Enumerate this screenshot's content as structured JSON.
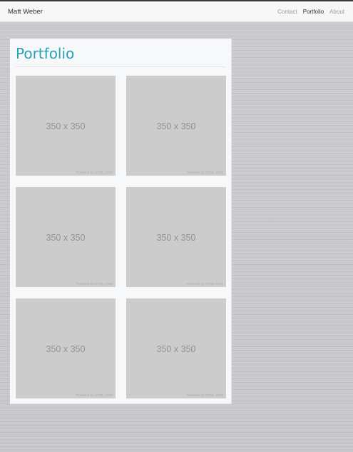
{
  "navbar": {
    "brand": "Matt Weber",
    "links": [
      {
        "label": "Contact",
        "active": false
      },
      {
        "label": "Portfolio",
        "active": true
      },
      {
        "label": "About",
        "active": false
      }
    ]
  },
  "panel": {
    "title": "Portfolio",
    "title_color": "#27a1b6"
  },
  "thumbnails": [
    {
      "size_label": "350 x 350",
      "credit": "Powered by HTML.COM"
    },
    {
      "size_label": "350 x 350",
      "credit": "Powered by HTML.COM"
    },
    {
      "size_label": "350 x 350",
      "credit": "Powered by HTML.COM"
    },
    {
      "size_label": "350 x 350",
      "credit": "Powered by HTML.COM"
    },
    {
      "size_label": "350 x 350",
      "credit": "Powered by HTML.COM"
    },
    {
      "size_label": "350 x 350",
      "credit": "Powered by HTML.COM"
    }
  ]
}
